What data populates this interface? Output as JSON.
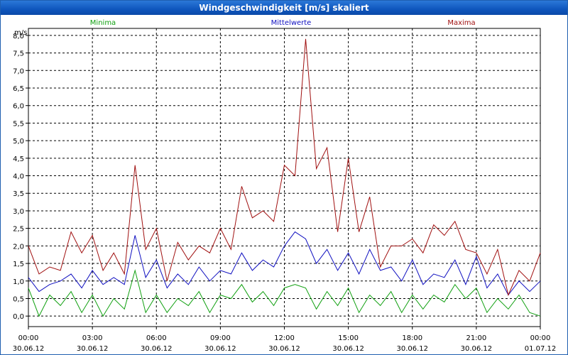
{
  "chart_data": {
    "type": "line",
    "title": "Windgeschwindigkeit [m/s] skaliert",
    "ylabel": "m/s",
    "ylim": [
      -0.3,
      8.2
    ],
    "grid": true,
    "legend_placement": "top",
    "y_ticks": [
      "0,0",
      "0,5",
      "1,0",
      "1,5",
      "2,0",
      "2,5",
      "3,0",
      "3,5",
      "4,0",
      "4,5",
      "5,0",
      "5,5",
      "6,0",
      "6,5",
      "7,0",
      "7,5",
      "8,0"
    ],
    "x_ticks": [
      {
        "time": "00:00",
        "date": "30.06.12"
      },
      {
        "time": "03:00",
        "date": "30.06.12"
      },
      {
        "time": "06:00",
        "date": "30.06.12"
      },
      {
        "time": "09:00",
        "date": "30.06.12"
      },
      {
        "time": "12:00",
        "date": "30.06.12"
      },
      {
        "time": "15:00",
        "date": "30.06.12"
      },
      {
        "time": "18:00",
        "date": "30.06.12"
      },
      {
        "time": "21:00",
        "date": "30.06.12"
      },
      {
        "time": "00:00",
        "date": "01.07.12"
      }
    ],
    "x_unit": "hours",
    "x_range": [
      0,
      24
    ],
    "series": [
      {
        "name": "Minima",
        "color": "#10a010",
        "hours": [
          0,
          0.5,
          1,
          1.5,
          2,
          2.5,
          3,
          3.5,
          4,
          4.5,
          5,
          5.5,
          6,
          6.5,
          7,
          7.5,
          8,
          8.5,
          9,
          9.5,
          10,
          10.5,
          11,
          11.5,
          12,
          12.5,
          13,
          13.5,
          14,
          14.5,
          15,
          15.5,
          16,
          16.5,
          17,
          17.5,
          18,
          18.5,
          19,
          19.5,
          20,
          20.5,
          21,
          21.5,
          22,
          22.5,
          23,
          23.5,
          24
        ],
        "values": [
          0.8,
          0.0,
          0.6,
          0.3,
          0.7,
          0.1,
          0.6,
          0.0,
          0.5,
          0.2,
          1.3,
          0.1,
          0.6,
          0.1,
          0.5,
          0.3,
          0.7,
          0.1,
          0.6,
          0.5,
          0.9,
          0.4,
          0.7,
          0.3,
          0.8,
          0.9,
          0.8,
          0.2,
          0.7,
          0.3,
          0.8,
          0.1,
          0.6,
          0.3,
          0.7,
          0.1,
          0.6,
          0.2,
          0.6,
          0.4,
          0.9,
          0.5,
          0.8,
          0.1,
          0.5,
          0.2,
          0.6,
          0.1,
          0.0
        ]
      },
      {
        "name": "Mittelwerte",
        "color": "#1010c0",
        "hours": [
          0,
          0.5,
          1,
          1.5,
          2,
          2.5,
          3,
          3.5,
          4,
          4.5,
          5,
          5.5,
          6,
          6.5,
          7,
          7.5,
          8,
          8.5,
          9,
          9.5,
          10,
          10.5,
          11,
          11.5,
          12,
          12.5,
          13,
          13.5,
          14,
          14.5,
          15,
          15.5,
          16,
          16.5,
          17,
          17.5,
          18,
          18.5,
          19,
          19.5,
          20,
          20.5,
          21,
          21.5,
          22,
          22.5,
          23,
          23.5,
          24
        ],
        "values": [
          1.1,
          0.7,
          0.9,
          1.0,
          1.2,
          0.8,
          1.3,
          0.9,
          1.1,
          0.9,
          2.3,
          1.1,
          1.6,
          0.8,
          1.2,
          0.9,
          1.4,
          1.0,
          1.3,
          1.2,
          1.8,
          1.3,
          1.6,
          1.4,
          2.0,
          2.4,
          2.2,
          1.5,
          1.9,
          1.3,
          1.8,
          1.2,
          1.9,
          1.3,
          1.4,
          1.0,
          1.6,
          0.9,
          1.2,
          1.1,
          1.6,
          0.9,
          1.7,
          0.8,
          1.2,
          0.6,
          1.0,
          0.7,
          1.0
        ]
      },
      {
        "name": "Maxima",
        "color": "#a01010",
        "hours": [
          0,
          0.5,
          1,
          1.5,
          2,
          2.5,
          3,
          3.5,
          4,
          4.5,
          5,
          5.5,
          6,
          6.5,
          7,
          7.5,
          8,
          8.5,
          9,
          9.5,
          10,
          10.5,
          11,
          11.5,
          12,
          12.5,
          13,
          13.5,
          14,
          14.5,
          15,
          15.5,
          16,
          16.5,
          17,
          17.5,
          18,
          18.5,
          19,
          19.5,
          20,
          20.5,
          21,
          21.5,
          22,
          22.5,
          23,
          23.5,
          24
        ],
        "values": [
          2.0,
          1.2,
          1.4,
          1.3,
          2.4,
          1.8,
          2.3,
          1.3,
          1.8,
          1.2,
          4.3,
          1.9,
          2.5,
          1.0,
          2.1,
          1.6,
          2.0,
          1.8,
          2.5,
          1.9,
          3.7,
          2.8,
          3.0,
          2.7,
          4.3,
          4.0,
          7.9,
          4.2,
          4.8,
          2.4,
          4.5,
          2.4,
          3.4,
          1.4,
          2.0,
          2.0,
          2.2,
          1.8,
          2.6,
          2.3,
          2.7,
          1.9,
          1.8,
          1.2,
          1.9,
          0.6,
          1.3,
          1.0,
          1.8
        ]
      }
    ]
  }
}
